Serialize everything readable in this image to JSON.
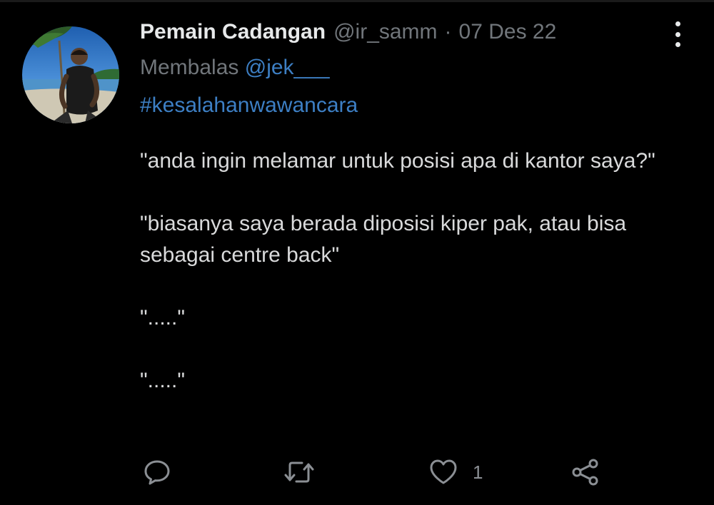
{
  "tweet": {
    "display_name": "Pemain Cadangan",
    "handle": "@ir_samm",
    "separator": "·",
    "date": "07 Des 22",
    "reply_prefix": "Membalas",
    "reply_to": "@jek___",
    "hashtag": "#kesalahanwawancara",
    "paragraphs": [
      "\"anda ingin melamar untuk posisi apa di kantor saya?\"",
      "\"biasanya saya berada diposisi kiper pak, atau bisa sebagai centre back\"",
      "\".....\"",
      "\".....\""
    ]
  },
  "actions": {
    "reply_icon": "reply-bubble-icon",
    "retweet_icon": "retweet-icon",
    "like_icon": "heart-icon",
    "like_count": "1",
    "share_icon": "share-icon"
  },
  "colors": {
    "background": "#000000",
    "name": "#e7e9ea",
    "muted": "#71767b",
    "link": "#3d7fc4",
    "body_text": "#d9dadb"
  }
}
